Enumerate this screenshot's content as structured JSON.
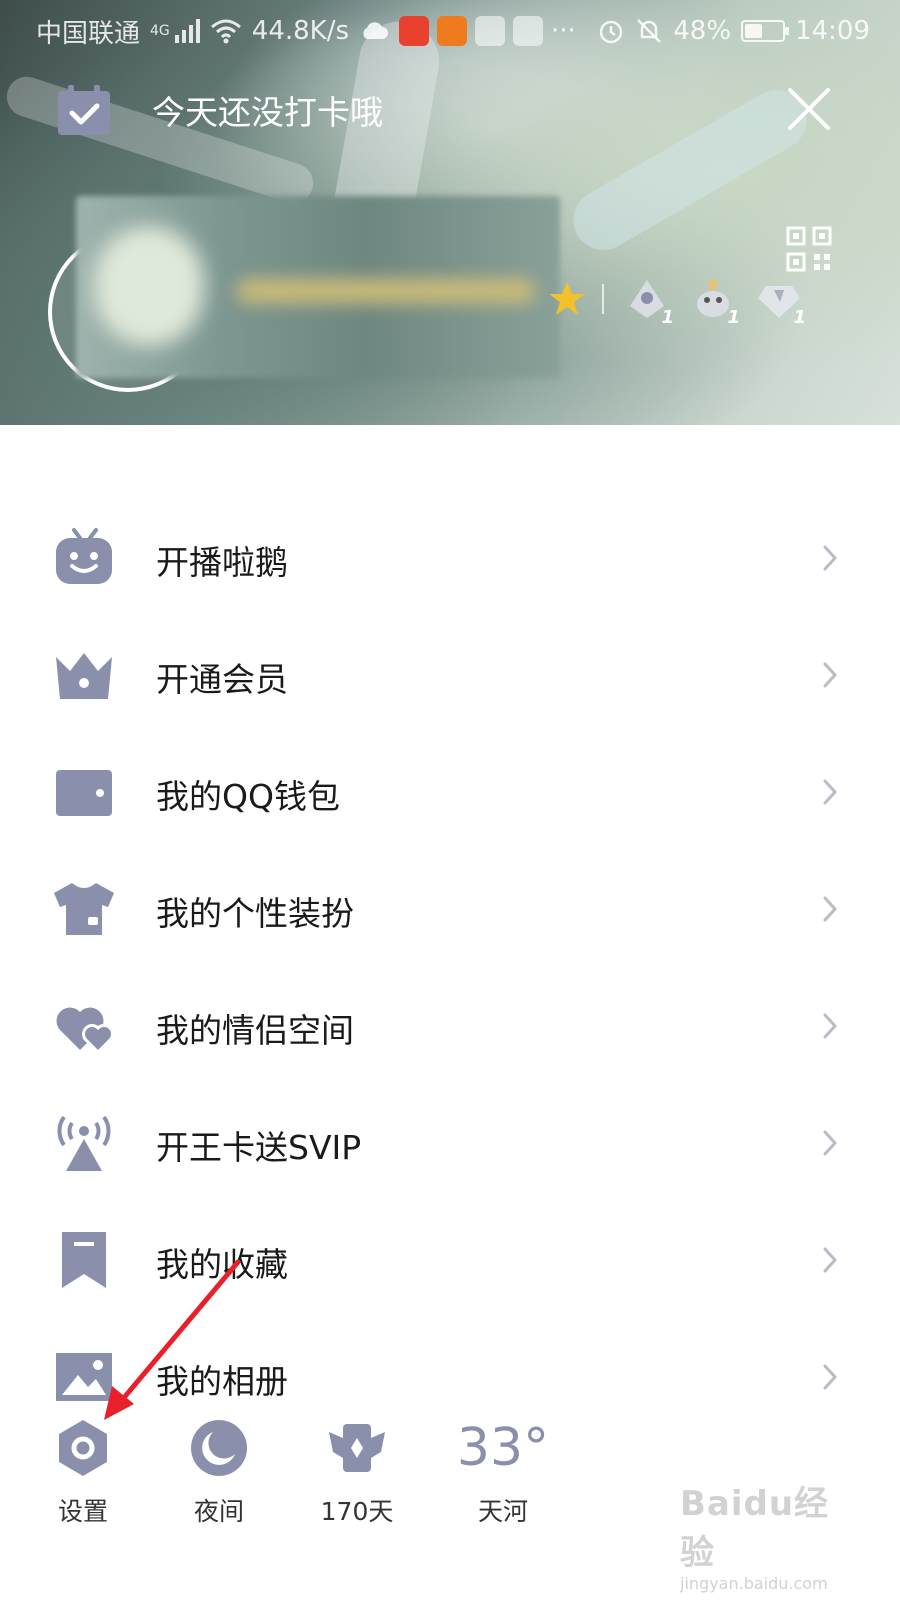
{
  "status_bar": {
    "carrier": "中国联通",
    "network": "4G",
    "speed": "44.8K/s",
    "more": "···",
    "battery_percent": "48%",
    "battery_level": 0.48,
    "time": "14:09",
    "app_badges": [
      "weibo",
      "hand-app",
      "HMS",
      "app-store"
    ]
  },
  "checkin": {
    "text": "今天还没打卡哦"
  },
  "profile": {
    "badge_counts": [
      "1",
      "1",
      "1"
    ]
  },
  "menu": {
    "items": [
      {
        "label": "开播啦鹅",
        "icon": "tv-robot-icon"
      },
      {
        "label": "开通会员",
        "icon": "crown-icon"
      },
      {
        "label": "我的QQ钱包",
        "icon": "wallet-icon"
      },
      {
        "label": "我的个性装扮",
        "icon": "tshirt-icon"
      },
      {
        "label": "我的情侣空间",
        "icon": "hearts-icon"
      },
      {
        "label": "开王卡送SVIP",
        "icon": "signal-tower-icon"
      },
      {
        "label": "我的收藏",
        "icon": "bookmark-icon"
      },
      {
        "label": "我的相册",
        "icon": "photo-icon"
      }
    ]
  },
  "bottom_bar": {
    "settings_label": "设置",
    "night_label": "夜间",
    "days_label": "170天",
    "temperature": "33°",
    "weather_label": "天河"
  },
  "watermark": {
    "line1": "Baidu经验",
    "line2": "jingyan.baidu.com"
  },
  "colors": {
    "icon": "#8a90ac",
    "text": "#1a1a1a",
    "chevron": "#b9bcc6",
    "annotation": "#e8202a"
  }
}
